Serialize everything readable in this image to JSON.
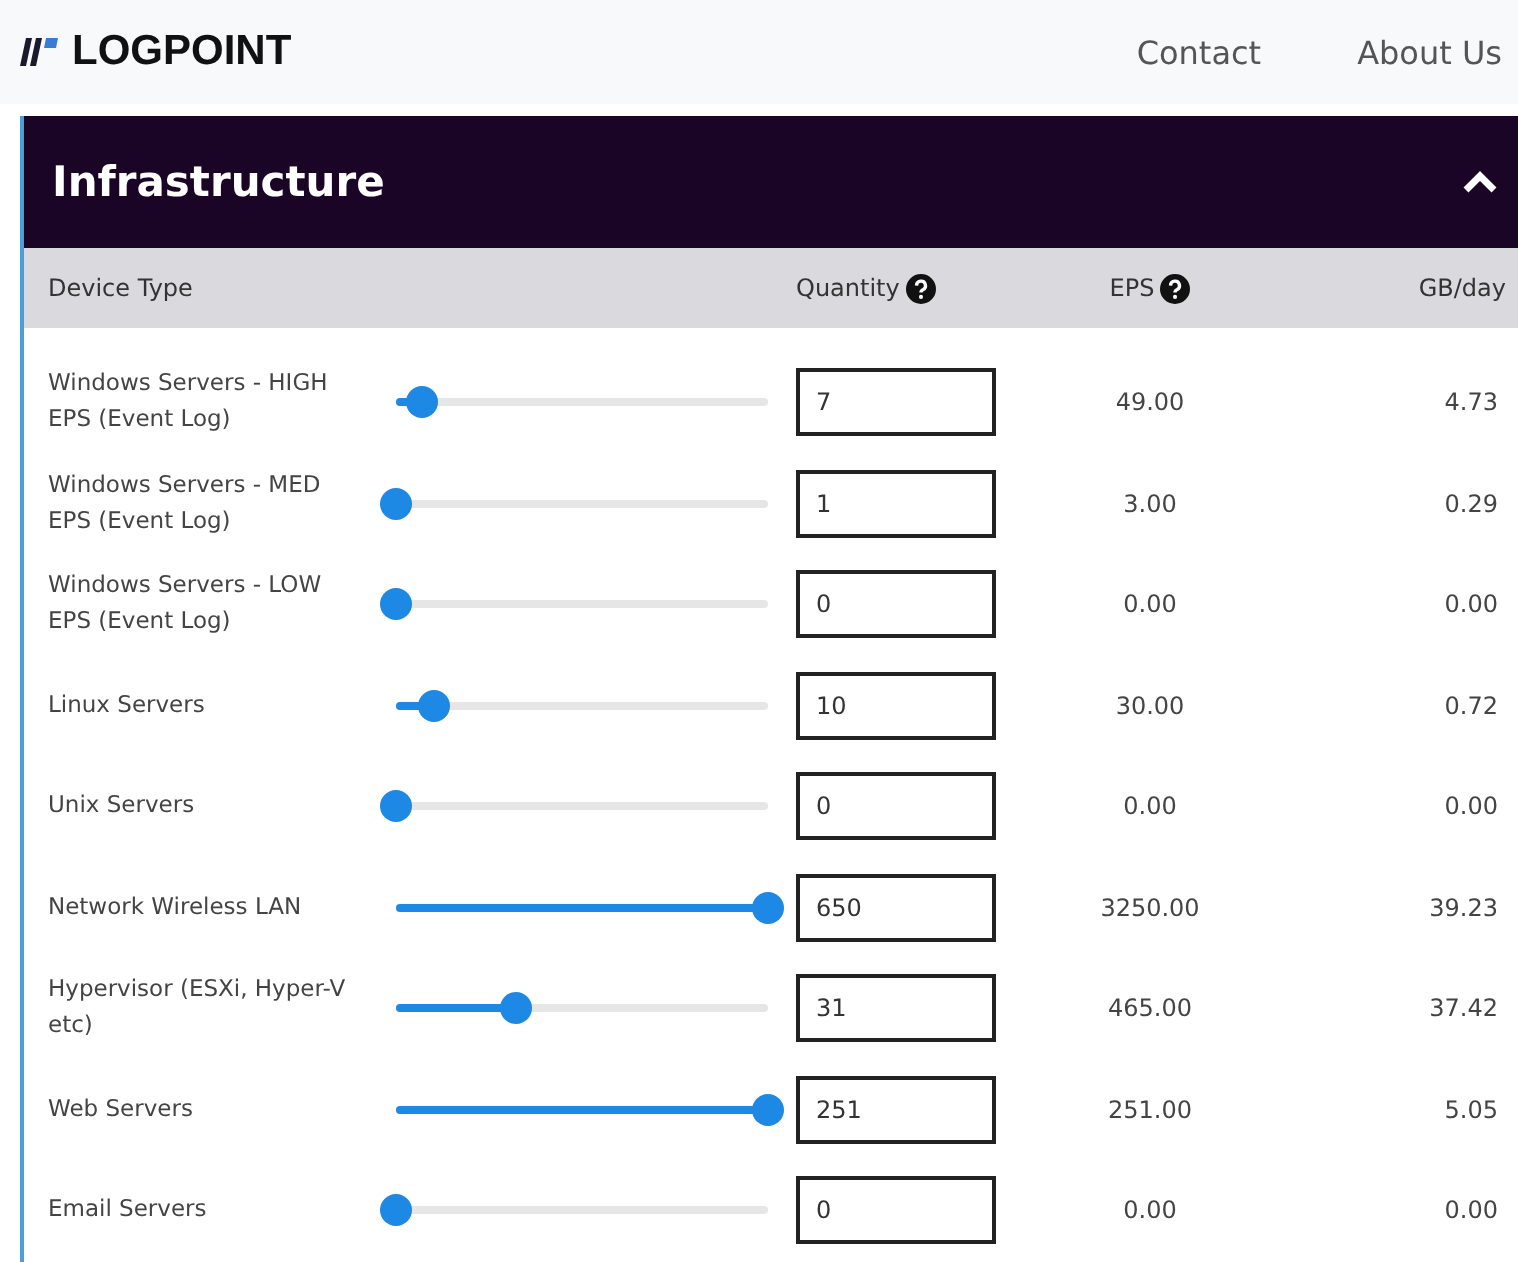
{
  "header": {
    "logo": "LOGPOINT",
    "nav": [
      "Contact",
      "About Us"
    ]
  },
  "panel": {
    "title": "Infrastructure",
    "expanded": true,
    "columns": [
      "Device Type",
      "Quantity",
      "EPS",
      "GB/day"
    ],
    "rows": [
      {
        "device": "Windows Servers - HIGH EPS (Event Log)",
        "level": 0.07,
        "quantity": "7",
        "eps": "49.00",
        "gb": "4.73"
      },
      {
        "device": "Windows Servers - MED EPS (Event Log)",
        "level": 0,
        "quantity": "1",
        "eps": "3.00",
        "gb": "0.29"
      },
      {
        "device": "Windows Servers - LOW EPS (Event Log)",
        "level": 0,
        "quantity": "0",
        "eps": "0.00",
        "gb": "0.00"
      },
      {
        "device": "Linux Servers",
        "level": 0.1,
        "quantity": "10",
        "eps": "30.00",
        "gb": "0.72"
      },
      {
        "device": "Unix Servers",
        "level": 0,
        "quantity": "0",
        "eps": "0.00",
        "gb": "0.00"
      },
      {
        "device": "Network Wireless LAN",
        "level": 1,
        "quantity": "650",
        "eps": "3250.00",
        "gb": "39.23"
      },
      {
        "device": "Hypervisor (ESXi, Hyper-V etc)",
        "level": 0.32,
        "quantity": "31",
        "eps": "465.00",
        "gb": "37.42"
      },
      {
        "device": "Web Servers",
        "level": 1,
        "quantity": "251",
        "eps": "251.00",
        "gb": "5.05"
      },
      {
        "device": "Email Servers",
        "level": 0,
        "quantity": "0",
        "eps": "0.00",
        "gb": "0.00"
      }
    ]
  }
}
